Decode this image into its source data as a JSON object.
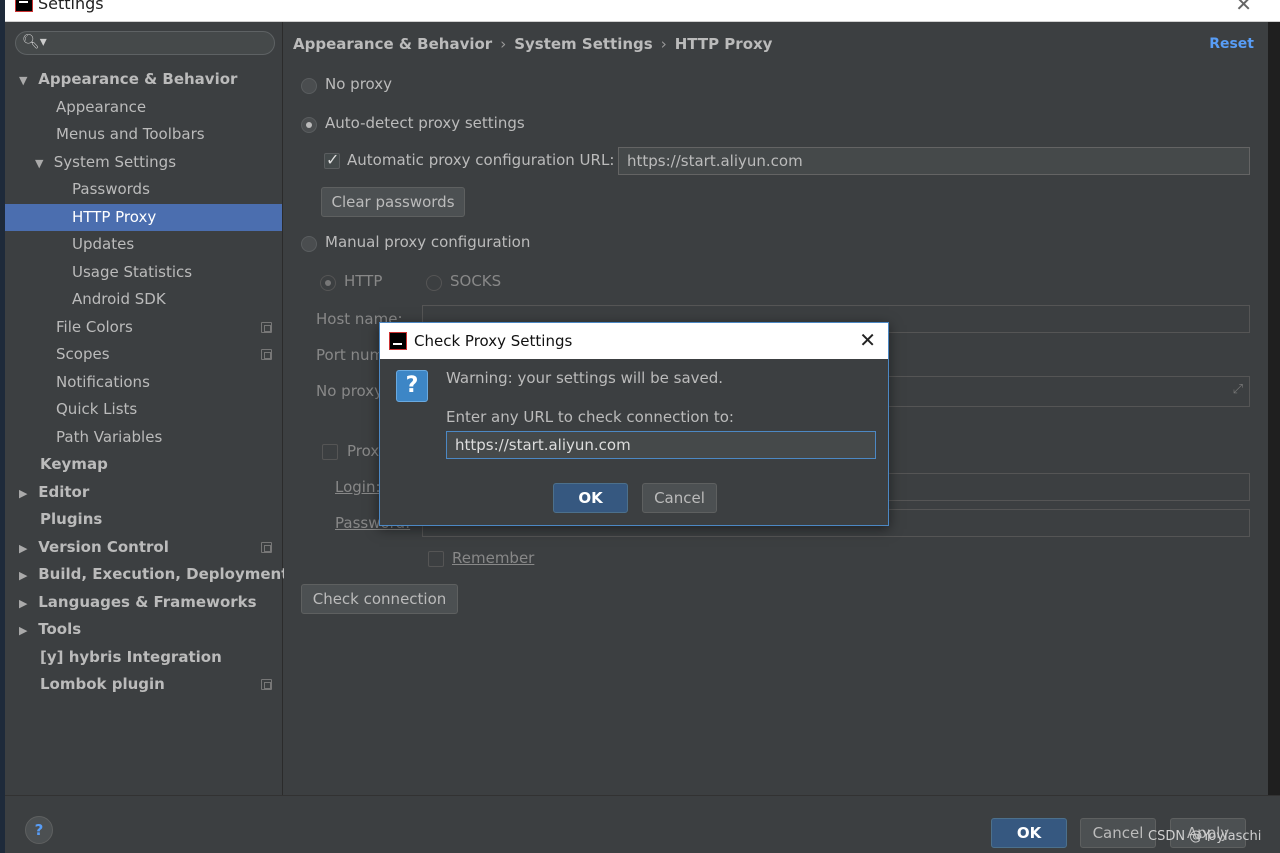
{
  "window": {
    "title": "Settings",
    "close_glyph": "✕"
  },
  "sidebar": {
    "search_icon": "🔍︎▾",
    "items": [
      {
        "label": "Appearance & Behavior",
        "arrow": "▼"
      },
      {
        "label": "Appearance"
      },
      {
        "label": "Menus and Toolbars"
      },
      {
        "label": "System Settings",
        "arrow": "▼"
      },
      {
        "label": "Passwords"
      },
      {
        "label": "HTTP Proxy"
      },
      {
        "label": "Updates"
      },
      {
        "label": "Usage Statistics"
      },
      {
        "label": "Android SDK"
      },
      {
        "label": "File Colors"
      },
      {
        "label": "Scopes"
      },
      {
        "label": "Notifications"
      },
      {
        "label": "Quick Lists"
      },
      {
        "label": "Path Variables"
      },
      {
        "label": "Keymap"
      },
      {
        "label": "Editor",
        "arrow": "▶"
      },
      {
        "label": "Plugins"
      },
      {
        "label": "Version Control",
        "arrow": "▶"
      },
      {
        "label": "Build, Execution, Deployment",
        "arrow": "▶"
      },
      {
        "label": "Languages & Frameworks",
        "arrow": "▶"
      },
      {
        "label": "Tools",
        "arrow": "▶"
      },
      {
        "label": "[y] hybris Integration"
      },
      {
        "label": "Lombok plugin"
      }
    ]
  },
  "breadcrumb": {
    "parts": [
      "Appearance & Behavior",
      "System Settings",
      "HTTP Proxy"
    ],
    "sep": "›"
  },
  "reset_label": "Reset",
  "proxy": {
    "no_proxy": "No proxy",
    "auto_detect": "Auto-detect proxy settings",
    "auto_config_label": "Automatic proxy configuration URL:",
    "auto_config_url": "https://start.aliyun.com",
    "clear_passwords": "Clear passwords",
    "manual": "Manual proxy configuration",
    "http": "HTTP",
    "socks": "SOCKS",
    "host_name": "Host name:",
    "port_number": "Port num",
    "no_proxy_for": "No proxy",
    "proxy_auth": "Prox",
    "login": "Login:",
    "password": "Password:",
    "remember": "Remember",
    "check_connection": "Check connection"
  },
  "footer": {
    "help_glyph": "?",
    "ok": "OK",
    "cancel": "Cancel",
    "apply": "Apply",
    "watermark": "CSDN @Yoyiaschi"
  },
  "dialog": {
    "title": "Check Proxy Settings",
    "close_glyph": "✕",
    "question_glyph": "?",
    "warning": "Warning: your settings will be saved.",
    "prompt": "Enter any URL to check connection to:",
    "url_value": "https://start.aliyun.com",
    "ok": "OK",
    "cancel": "Cancel"
  },
  "colors": {
    "accent": "#4b6eaf",
    "link": "#589df6",
    "primary_button": "#365880"
  }
}
